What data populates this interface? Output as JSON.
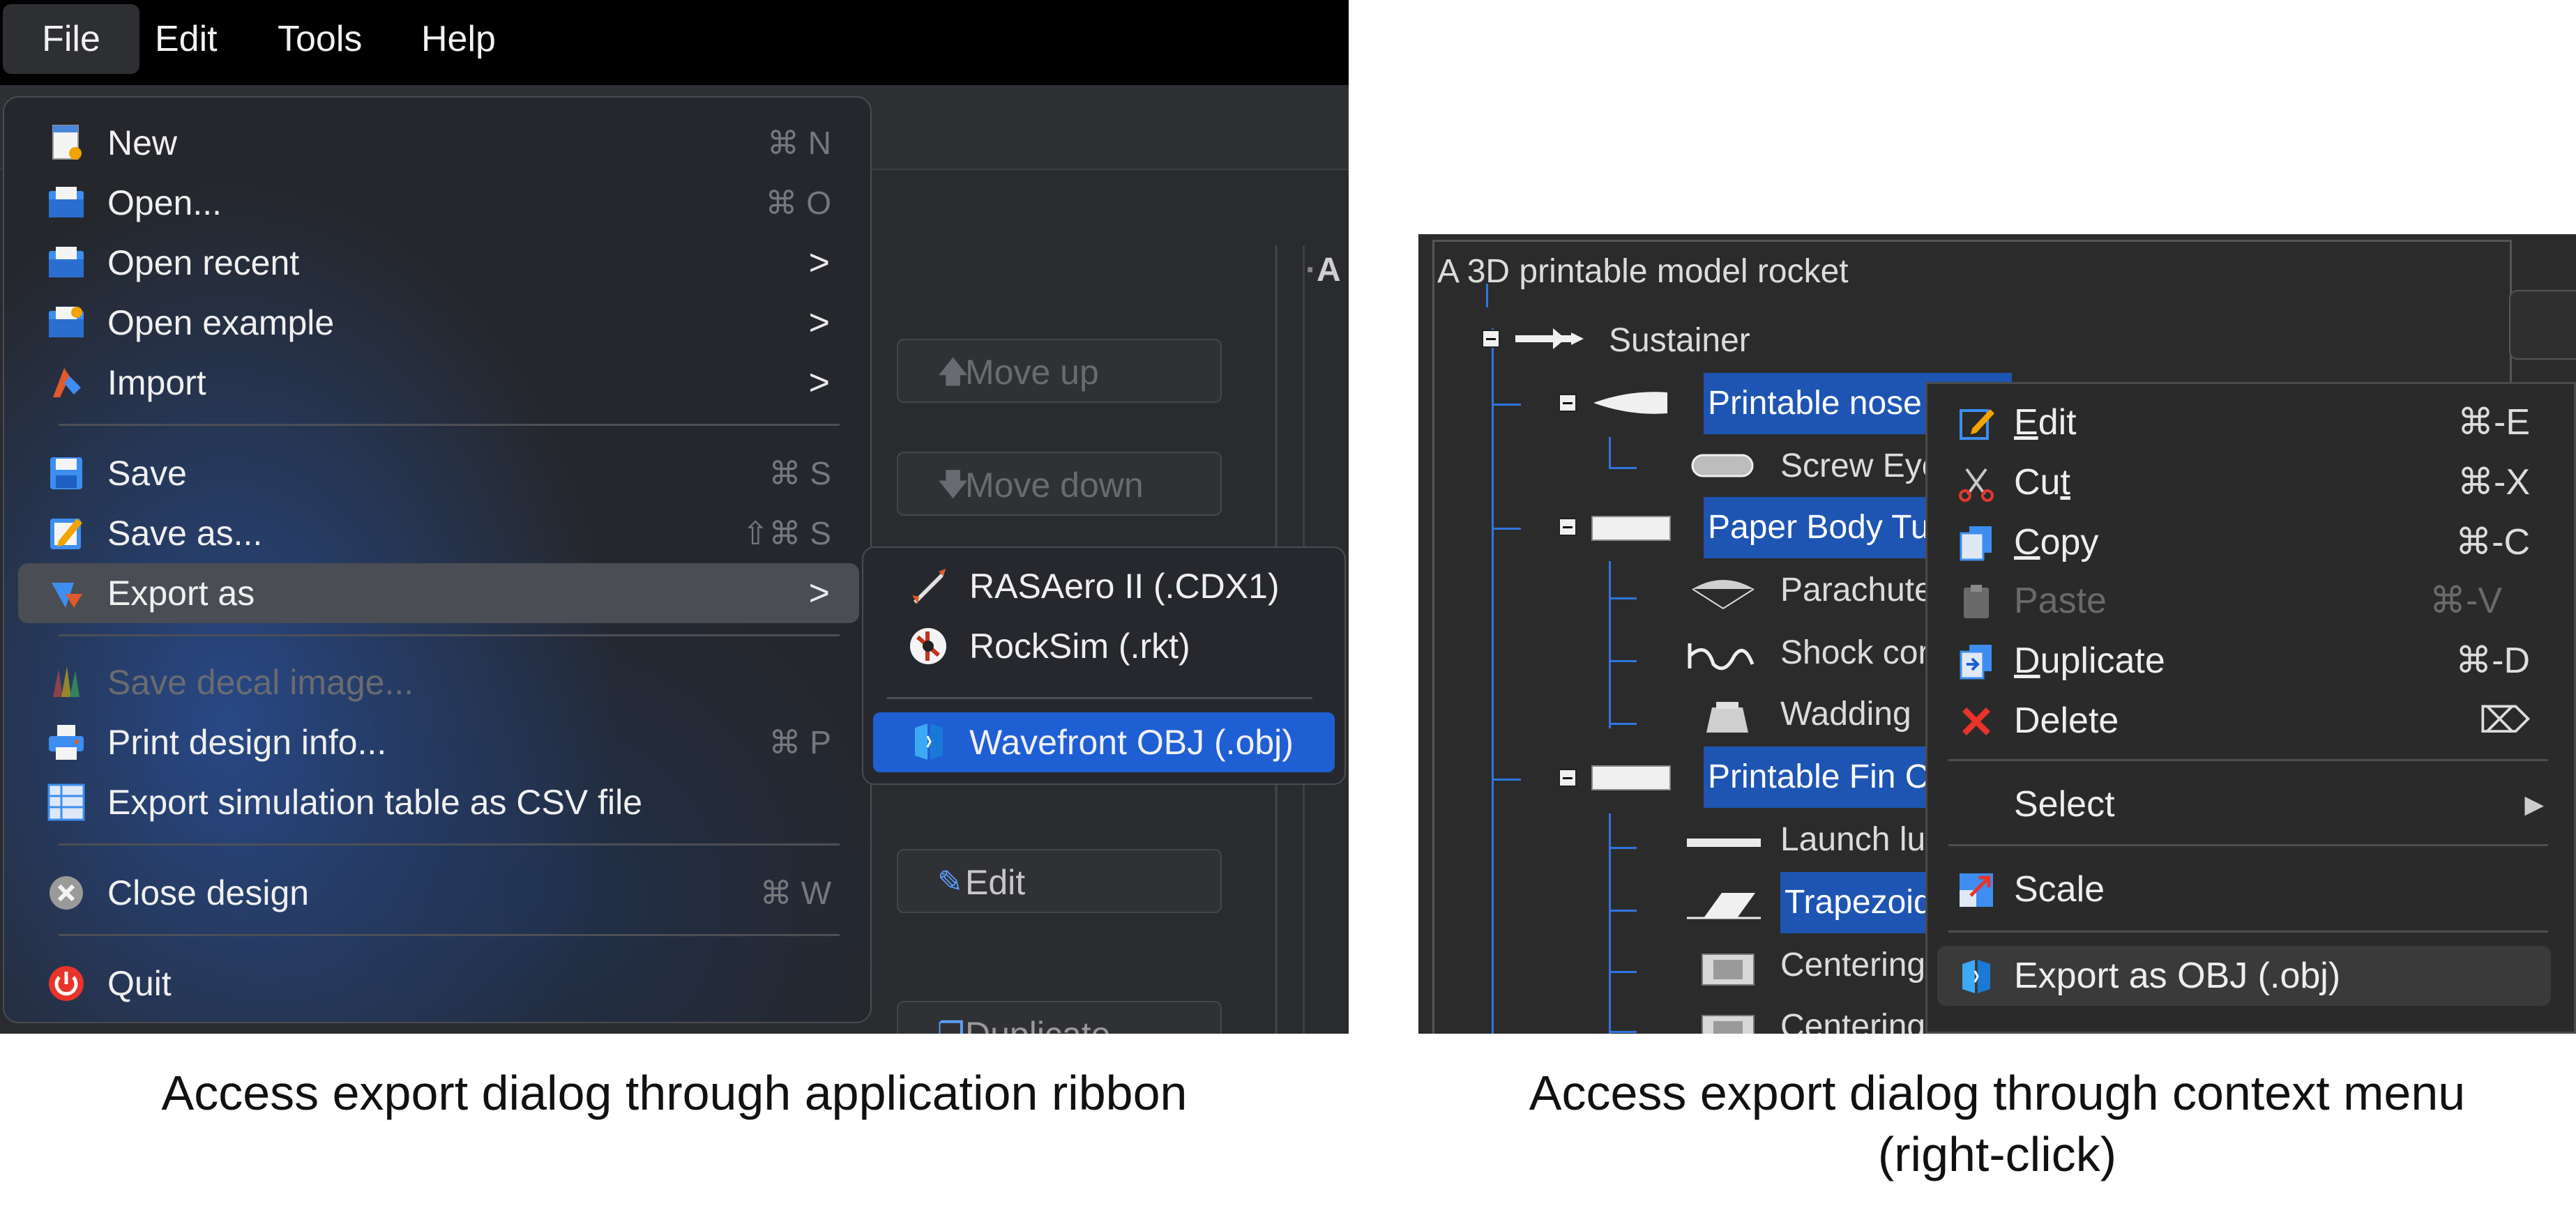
{
  "menubar": {
    "items": [
      "File",
      "Edit",
      "Tools",
      "Help"
    ]
  },
  "background_panel": {
    "move_up": "Move up",
    "move_down": "Move down",
    "edit": "Edit",
    "duplicate": "Duplicate",
    "column_label": "A"
  },
  "file_menu": {
    "items": [
      {
        "label": "New",
        "shortcut": "⌘ N",
        "icon": "new-file-icon"
      },
      {
        "label": "Open...",
        "shortcut": "⌘ O",
        "icon": "open-folder-icon"
      },
      {
        "label": "Open recent",
        "icon": "open-recent-icon"
      },
      {
        "label": "Open example",
        "icon": "open-example-icon"
      },
      {
        "label": "Import",
        "icon": "import-icon"
      },
      {
        "label": "Save",
        "shortcut": "⌘ S",
        "icon": "save-icon"
      },
      {
        "label": "Save as...",
        "shortcut": "⇧⌘ S",
        "icon": "save-as-icon"
      },
      {
        "label": "Export as",
        "icon": "export-icon"
      },
      {
        "label": "Save decal image...",
        "icon": "decal-icon"
      },
      {
        "label": "Print design info...",
        "shortcut": "⌘ P",
        "icon": "print-icon"
      },
      {
        "label": "Export simulation table as CSV file",
        "icon": "csv-table-icon"
      },
      {
        "label": "Close design",
        "shortcut": "⌘ W",
        "icon": "close-design-icon"
      },
      {
        "label": "Quit",
        "icon": "quit-icon"
      }
    ],
    "submenu_arrow": ">"
  },
  "export_submenu": {
    "items": [
      {
        "label": "RASAero II (.CDX1)",
        "icon": "rasaero-rocket-icon"
      },
      {
        "label": "RockSim (.rkt)",
        "icon": "rocksim-icon"
      },
      {
        "label": "Wavefront OBJ (.obj)",
        "icon": "obj-cube-icon"
      }
    ]
  },
  "component_tree": {
    "root": "A 3D printable model rocket",
    "nodes": [
      {
        "label": "Sustainer",
        "icon": "sustainer-icon"
      },
      {
        "label": "Printable nose c",
        "icon": "nosecone-icon"
      },
      {
        "label": "Screw Eye",
        "icon": "screw-eye-icon"
      },
      {
        "label": "Paper Body Tub",
        "icon": "body-tube-icon"
      },
      {
        "label": "Parachute",
        "icon": "parachute-icon"
      },
      {
        "label": "Shock cord",
        "icon": "shock-cord-icon"
      },
      {
        "label": "Wadding",
        "icon": "wadding-icon"
      },
      {
        "label": "Printable Fin Ca",
        "icon": "fin-can-icon"
      },
      {
        "label": "Launch lug",
        "icon": "launch-lug-icon"
      },
      {
        "label": "Trapezoida",
        "icon": "trapezoidal-fin-icon"
      },
      {
        "label": "Centering",
        "icon": "centering-ring-icon"
      },
      {
        "label": "Centering",
        "icon": "centering-ring-icon"
      }
    ]
  },
  "context_menu": {
    "items": [
      {
        "label": "Edit",
        "mnemonic_index": 0,
        "shortcut": "⌘-E",
        "icon": "edit-icon"
      },
      {
        "label": "Cut",
        "mnemonic_index": 2,
        "shortcut": "⌘-X",
        "icon": "scissors-icon"
      },
      {
        "label": "Copy",
        "mnemonic_index": 0,
        "shortcut": "⌘-C",
        "icon": "copy-icon"
      },
      {
        "label": "Paste",
        "shortcut": "⌘-V",
        "icon": "paste-icon"
      },
      {
        "label": "Duplicate",
        "mnemonic_index": 0,
        "shortcut": "⌘-D",
        "icon": "duplicate-icon"
      },
      {
        "label": "Delete",
        "shortcut": "⌦",
        "icon": "delete-x-icon"
      },
      {
        "label": "Select",
        "icon": "none"
      },
      {
        "label": "Scale",
        "icon": "scale-icon"
      },
      {
        "label": "Export as OBJ (.obj)",
        "icon": "obj-cube-icon"
      }
    ],
    "submenu_arrow": "▶"
  },
  "captions": {
    "left": "Access export dialog through application ribbon",
    "right_line1": "Access export dialog through context menu",
    "right_line2": "(right-click)"
  },
  "colors": {
    "highlight_blue": "#1f5fd4",
    "tree_selection": "#1e55b3",
    "tree_lines": "#2f76e0",
    "menu_bg": "#25272c",
    "context_bg": "#2a2a2a"
  }
}
